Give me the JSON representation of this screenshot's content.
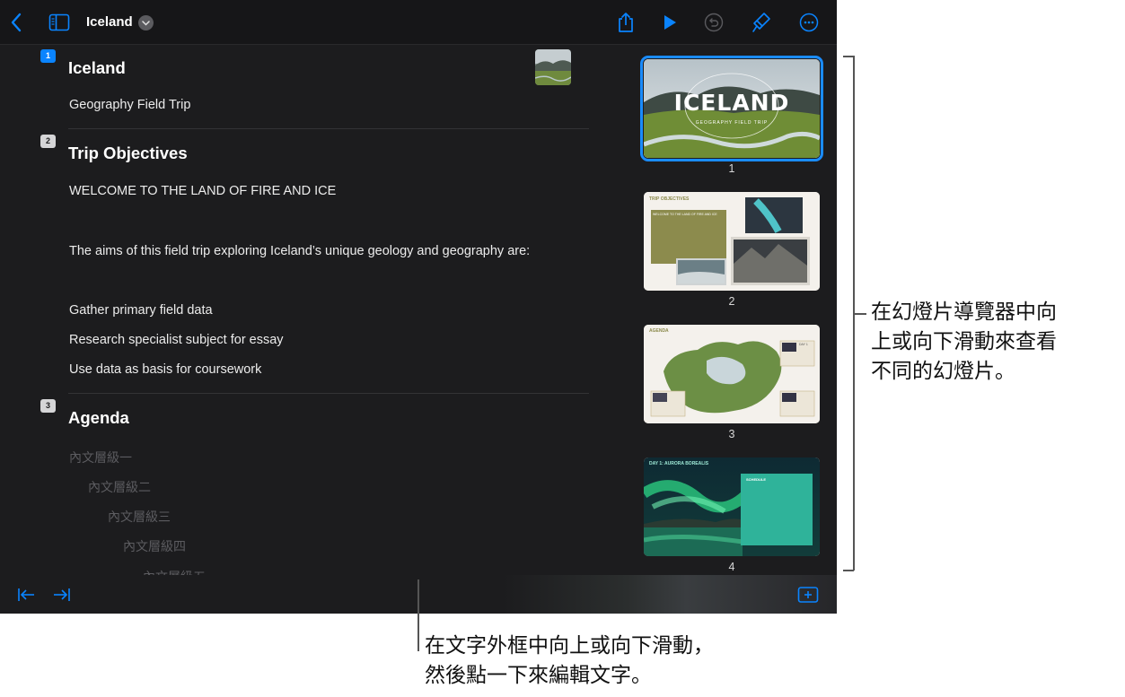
{
  "toolbar": {
    "title": "Iceland",
    "icons": [
      "back-chevron-icon",
      "sidebar-icon",
      "share-icon",
      "play-icon",
      "undo-icon",
      "format-brush-icon",
      "more-icon"
    ]
  },
  "outline": {
    "slides": [
      {
        "number": "1",
        "title": "Iceland",
        "lines": [
          "Geography Field Trip"
        ]
      },
      {
        "number": "2",
        "title": "Trip Objectives",
        "lines": [
          "WELCOME TO THE LAND OF FIRE AND ICE",
          "The aims of this field trip exploring Iceland’s unique geology and geography are:",
          "Gather primary field data",
          "Research specialist subject for essay",
          "Use data as basis for coursework"
        ]
      },
      {
        "number": "3",
        "title": "Agenda",
        "lines": [
          "內文層級一",
          "內文層級二",
          "內文層級三",
          "內文層級四",
          "內文層級五"
        ]
      }
    ]
  },
  "navigator": {
    "thumbs": [
      {
        "number": "1",
        "heading": "ICELAND",
        "sub": "GEOGRAPHY FIELD TRIP"
      },
      {
        "number": "2",
        "heading": "TRIP OBJECTIVES",
        "sub": "WELCOME TO THE LAND OF FIRE AND ICE"
      },
      {
        "number": "3",
        "heading": "AGENDA",
        "sub": "DAY 1"
      },
      {
        "number": "4",
        "heading": "DAY 1: AURORA BOREALIS",
        "sub": "SCHEDULE"
      }
    ]
  },
  "bottombar": {
    "icons": [
      "outdent-icon",
      "indent-icon",
      "add-slide-icon"
    ]
  },
  "callouts": {
    "navigator_line1": "在幻燈片導覽器中向",
    "navigator_line2": "上或向下滑動來查看",
    "navigator_line3": "不同的幻燈片。",
    "text_line1": "在文字外框中向上或向下滑動，",
    "text_line2": "然後點一下來編輯文字。"
  },
  "colors": {
    "accent": "#0a84ff",
    "background": "#1c1c1e"
  }
}
